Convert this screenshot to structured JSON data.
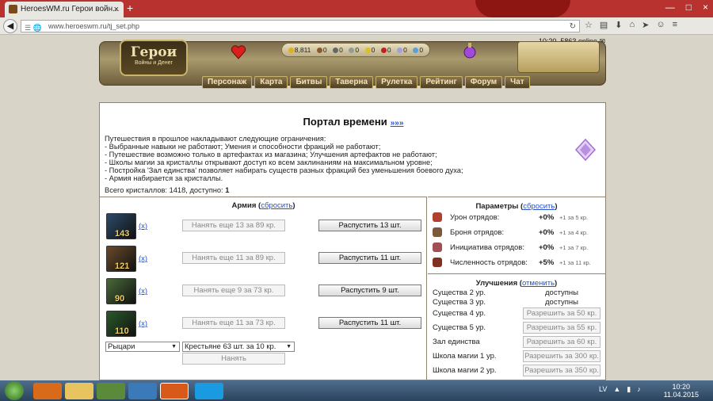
{
  "browser": {
    "tab_title": "HeroesWM.ru Герои войн...",
    "tab_close": "×",
    "new_tab": "+",
    "url": "www.heroeswm.ru/tj_set.php",
    "window_controls": [
      "—",
      "□",
      "×"
    ]
  },
  "game": {
    "online_text": "10:20, 5863 online",
    "logo_title": "Герои",
    "logo_subtitle": "Войны и Денег",
    "resources": [
      {
        "icon": "gold-icon",
        "value": "8,811",
        "color": "#e0b020"
      },
      {
        "icon": "wood-icon",
        "value": "0",
        "color": "#8a5a2a"
      },
      {
        "icon": "ore-icon",
        "value": "0",
        "color": "#666666"
      },
      {
        "icon": "mercury-icon",
        "value": "0",
        "color": "#999999"
      },
      {
        "icon": "sulfur-icon",
        "value": "0",
        "color": "#e0c020"
      },
      {
        "icon": "crystal-res-icon",
        "value": "0",
        "color": "#c02020"
      },
      {
        "icon": "gems-icon",
        "value": "0",
        "color": "#a0a0e0"
      },
      {
        "icon": "diamond-icon",
        "value": "0",
        "color": "#5aa0e0"
      }
    ],
    "menu": [
      "Персонаж",
      "Карта",
      "Битвы",
      "Таверна",
      "Рулетка",
      "Рейтинг",
      "Форум",
      "Чат"
    ]
  },
  "portal": {
    "title": "Портал времени",
    "title_link": "»»»",
    "info_lines": [
      "Путешествия в прошлое накладывают следующие ограничения:",
      "- Выбранные навыки не работают; Умения и способности фракций не работают;",
      "- Путешествие возможно только в артефактах из магазина; Улучшения артефактов не работают;",
      "- Школы магии за кристаллы открывают доступ ко всем заклинаниям на максимальном уровне;",
      "- Постройка 'Зал единства' позволяет набирать существ разных фракций без уменьшения боевого духа;",
      "- Армия набирается за кристаллы."
    ],
    "crystals_label": "Всего кристаллов: 1418, доступно:",
    "crystals_available": "1"
  },
  "army": {
    "title": "Армия",
    "reset": "сбросить",
    "units": [
      {
        "count": "143",
        "x": "(x)",
        "hire": "Нанять еще 13 за 89 кр.",
        "dismiss": "Распустить 13 шт.",
        "color": "#2c4a6a"
      },
      {
        "count": "121",
        "x": "(x)",
        "hire": "Нанять еще 11 за 89 кр.",
        "dismiss": "Распустить 11 шт.",
        "color": "#6a4a2a"
      },
      {
        "count": "90",
        "x": "(x)",
        "hire": "Нанять еще 9 за 73 кр.",
        "dismiss": "Распустить 9 шт.",
        "color": "#4a6a3a"
      },
      {
        "count": "110",
        "x": "(x)",
        "hire": "Нанять еще 11 за 73 кр.",
        "dismiss": "Распустить 11 шт.",
        "color": "#2a5a2a"
      }
    ],
    "faction_select": "Рыцари",
    "peasant_select": "Крестьяне 63 шт. за 10 кр.",
    "hire_button": "Нанять"
  },
  "params": {
    "title": "Параметры",
    "reset": "сбросить",
    "items": [
      {
        "label": "Урон отрядов:",
        "value": "+0%",
        "cost": "+1 за 5 кр.",
        "color": "#b04030"
      },
      {
        "label": "Броня отрядов:",
        "value": "+0%",
        "cost": "+1 за 4 кр.",
        "color": "#7a5a3a"
      },
      {
        "label": "Инициатива отрядов:",
        "value": "+0%",
        "cost": "+1 за 7 кр.",
        "color": "#a05050"
      },
      {
        "label": "Численность отрядов:",
        "value": "+5%",
        "cost": "+1 за 11 кр.",
        "color": "#803020"
      }
    ]
  },
  "upgrades": {
    "title": "Улучшения",
    "cancel": "отменить",
    "items": [
      {
        "label": "Существа 2 ур.",
        "status": "доступны"
      },
      {
        "label": "Существа 3 ур.",
        "status": "доступны"
      },
      {
        "label": "Существа 4 ур.",
        "button": "Разрешить за 50 кр."
      },
      {
        "label": "Существа 5 ур.",
        "button": "Разрешить за 55 кр."
      },
      {
        "label": "Зал единства",
        "button": "Разрешить за 60 кр."
      },
      {
        "label": "Школа магии 1 ур.",
        "button": "Разрешить за 300 кр."
      },
      {
        "label": "Школа магии 2 ур.",
        "button": "Разрешить за 350 кр."
      }
    ]
  },
  "taskbar": {
    "lang": "LV",
    "time": "10:20",
    "date": "11.04.2015"
  }
}
